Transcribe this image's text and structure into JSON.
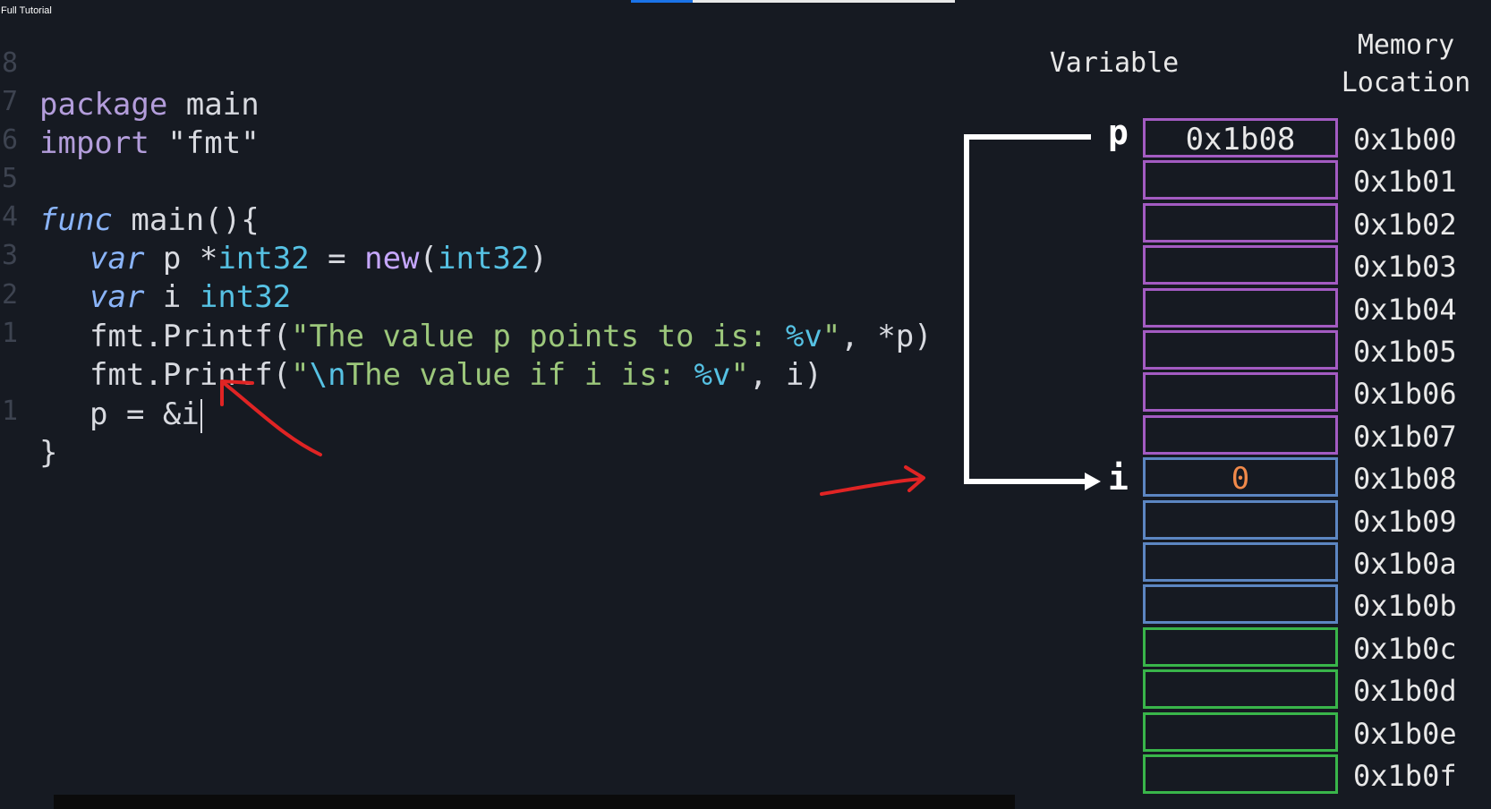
{
  "window": {
    "tag": "Full Tutorial"
  },
  "video": {
    "progress": 0.19
  },
  "editor": {
    "lines": [
      {
        "num": "8",
        "code": "package main"
      },
      {
        "num": "7",
        "code": "import \"fmt\""
      },
      {
        "num": "6",
        "code": ""
      },
      {
        "num": "5",
        "code": "func main(){"
      },
      {
        "num": "4",
        "code": "var p *int32 = new(int32)"
      },
      {
        "num": "3",
        "code": "var i int32"
      },
      {
        "num": "2",
        "code": "fmt.Printf(\"The value p points to is: %v\", *p)"
      },
      {
        "num": "1",
        "code": "fmt.Printf(\"\\nThe value if i is: %v\", i)"
      },
      {
        "num": "",
        "code": "p = &i"
      },
      {
        "num": "1",
        "code": "}"
      }
    ]
  },
  "diagram": {
    "header_variable": "Variable",
    "header_memory_line1": "Memory",
    "header_memory_line2": "Location",
    "var_p": "p",
    "var_i": "i",
    "cells": [
      {
        "addr": "0x1b00",
        "value": "0x1b08",
        "color": "#a35bc2"
      },
      {
        "addr": "0x1b01",
        "value": "",
        "color": "#a35bc2"
      },
      {
        "addr": "0x1b02",
        "value": "",
        "color": "#a35bc2"
      },
      {
        "addr": "0x1b03",
        "value": "",
        "color": "#a35bc2"
      },
      {
        "addr": "0x1b04",
        "value": "",
        "color": "#a35bc2"
      },
      {
        "addr": "0x1b05",
        "value": "",
        "color": "#a35bc2"
      },
      {
        "addr": "0x1b06",
        "value": "",
        "color": "#a35bc2"
      },
      {
        "addr": "0x1b07",
        "value": "",
        "color": "#a35bc2"
      },
      {
        "addr": "0x1b08",
        "value": "0",
        "color": "#5c86c2"
      },
      {
        "addr": "0x1b09",
        "value": "",
        "color": "#5c86c2"
      },
      {
        "addr": "0x1b0a",
        "value": "",
        "color": "#5c86c2"
      },
      {
        "addr": "0x1b0b",
        "value": "",
        "color": "#5c86c2"
      },
      {
        "addr": "0x1b0c",
        "value": "",
        "color": "#39b54a"
      },
      {
        "addr": "0x1b0d",
        "value": "",
        "color": "#39b54a"
      },
      {
        "addr": "0x1b0e",
        "value": "",
        "color": "#39b54a"
      },
      {
        "addr": "0x1b0f",
        "value": "",
        "color": "#39b54a"
      }
    ],
    "value_i_color": "#f0894a",
    "annotation_color": "#e02424"
  }
}
